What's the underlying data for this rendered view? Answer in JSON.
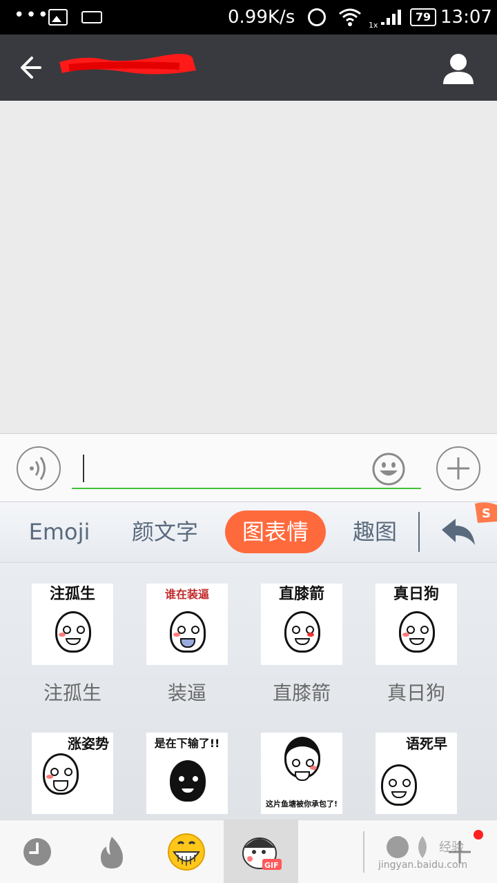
{
  "status_bar": {
    "dots": "•••",
    "speed": "0.99K/s",
    "signal_label": "1x",
    "battery": "79",
    "time": "13:07"
  },
  "title_bar": {
    "title": "",
    "redacted_color": "#ff1a1a"
  },
  "input_bar": {
    "text_value": "",
    "placeholder": ""
  },
  "keyboard": {
    "tabs": [
      {
        "label": "Emoji",
        "active": false
      },
      {
        "label": "颜文字",
        "active": false
      },
      {
        "label": "图表情",
        "active": true
      },
      {
        "label": "趣图",
        "active": false
      }
    ],
    "accent_color": "#ff6a3d"
  },
  "stickers": [
    {
      "label": "注孤生",
      "caption": "注孤生"
    },
    {
      "label": "装逼",
      "caption": "谁在装逼"
    },
    {
      "label": "直膝箭",
      "caption": "直膝箭"
    },
    {
      "label": "真日狗",
      "caption": "真日狗"
    },
    {
      "label": "",
      "caption": "涨姿势"
    },
    {
      "label": "",
      "caption": "是在下输了!!"
    },
    {
      "label": "",
      "caption": "这片鱼塘被你承包了!"
    },
    {
      "label": "",
      "caption": "语死早"
    }
  ],
  "bottom_bar": {
    "items": [
      "clock-icon",
      "fire-icon",
      "grin-emoji-icon",
      "gif-sticker-icon"
    ],
    "gif_badge": "GIF"
  },
  "watermark": {
    "text": "jingyan.baidu.com"
  }
}
